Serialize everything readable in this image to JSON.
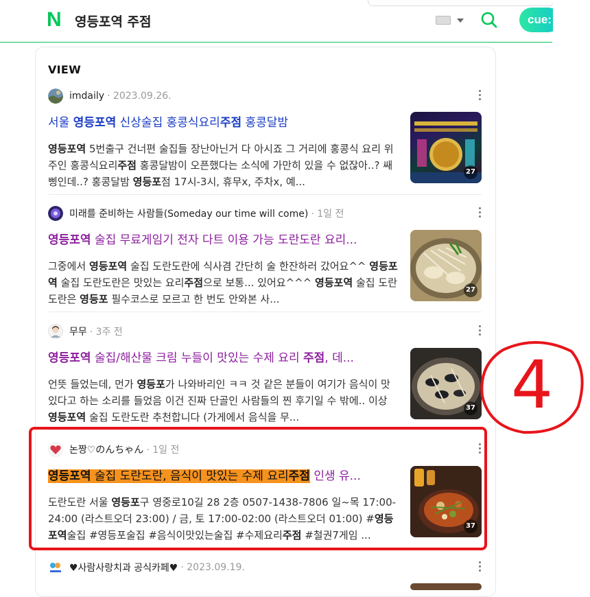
{
  "header": {
    "logo": "N",
    "query": "영등포역 주점",
    "cue_label": "cue:"
  },
  "section": {
    "title": "VIEW"
  },
  "posts": [
    {
      "author": "imdaily",
      "date": "· 2023.09.26.",
      "title_parts": [
        {
          "t": "서울 ",
          "b": false
        },
        {
          "t": "영등포역",
          "b": true
        },
        {
          "t": " 신상술집 홍콩식요리",
          "b": false
        },
        {
          "t": "주점",
          "b": true
        },
        {
          "t": " 홍콩달밤",
          "b": false
        }
      ],
      "title_color": "#1a3cc4",
      "desc": "<b>영등포역</b> 5번출구 건너편 술집들 장난아닌거 다 아시죠 그 거리에 홍콩식 요리 위주인 홍콩식요리<b>주점</b> 홍콩달밤이 오픈했다는 소식에 가만히 있을 수 없잖아..? 쌔삥인데..? 홍콩달밤 <b>영등포</b>점 17시-3시, 휴무x, 주차x, 예...",
      "image_count": "27"
    },
    {
      "author": "미래를 준비하는 사람들(Someday our time will come)",
      "date": "· 1일 전",
      "title_parts": [
        {
          "t": "영등포역",
          "b": true
        },
        {
          "t": " 술집 무료게임기 전자 다트 이용 가능 도란도란 요리...",
          "b": false
        }
      ],
      "title_color": "#8c1e9e",
      "desc": "그중에서 <b>영등포역</b> 술집 도란도란에 식사겸 간단히 술 한잔하러 갔어요^^ <b>영등포역</b> 술집 도란도란은 맛있는 요리<b>주점</b>으로 보통... 있어요^^^ <b>영등포역</b> 술집 도란도란은 <b>영등포</b> 필수코스로 모르고 한 번도 안와본 사...",
      "image_count": "27"
    },
    {
      "author": "무무",
      "date": "· 3주 전",
      "title_parts": [
        {
          "t": "영등포역",
          "b": true
        },
        {
          "t": " 술집/해산물 크림 누들이 맛있는 수제 요리 ",
          "b": false
        },
        {
          "t": "주점",
          "b": true
        },
        {
          "t": ", 데...",
          "b": false
        }
      ],
      "title_color": "#8c1e9e",
      "desc": "언뜻 들었는데, 먼가 <b>영등포</b>가 나와바리인 ㅋㅋ 것 같은 분들이 여기가 음식이 맛있다고 하는 소리를 들었음 이건 진짜 단골인 사람들의 찐 후기일 수 밖에.. 이상 <b>영등포역</b> 술집 도란도란 추천합니다 (가게에서 음식을 무...",
      "image_count": "37"
    },
    {
      "author": "논짱♡のんちゃん",
      "date": "· 1일 전",
      "title_parts": [
        {
          "t": "영등포역",
          "b": true,
          "hl": true
        },
        {
          "t": " 술집 도란도란, 음식이 맛있는 수제 요리",
          "b": false,
          "hl": true
        },
        {
          "t": "주점",
          "b": true,
          "hl": true
        },
        {
          "t": " 인생 ",
          "b": false
        },
        {
          "t": "유...",
          "b": false
        }
      ],
      "title_color": "#8c1e9e",
      "desc": "도란도란 서울 <b>영등포</b>구 영중로10길 28 2층 0507-1438-7806 일~목 17:00-24:00 (라스트오더 23:00) / 금, 토 17:00-02:00 (라스트오더 01:00) #<b>영등포역</b>술집 #영등포술집 #음식이맛있는술집 #수제요리<b>주점</b> #철권7게임 ...",
      "image_count": "37"
    },
    {
      "author": "♥사람사랑치과 공식카페♥",
      "date": "· 2023.09.19.",
      "title_parts": [],
      "title_color": "#1a3cc4",
      "desc": "",
      "image_count": ""
    }
  ],
  "annotation": {
    "number": "4",
    "color": "#e8141b"
  }
}
